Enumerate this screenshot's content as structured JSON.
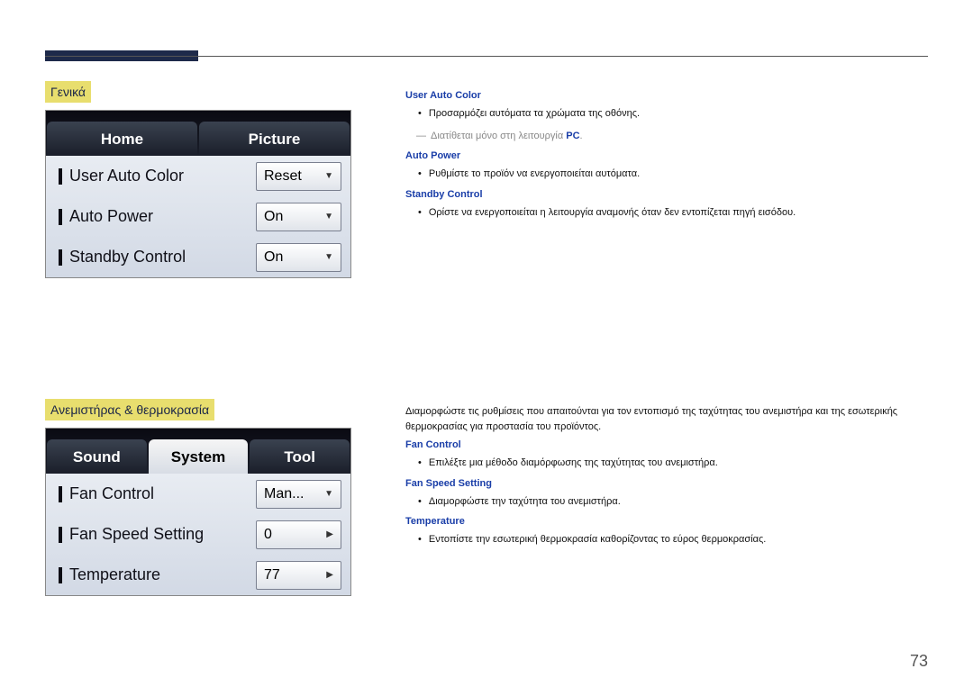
{
  "page_number": "73",
  "section1": {
    "label": "Γενικά",
    "tabs": [
      "Home",
      "Picture"
    ],
    "active_tab_index": 0,
    "rows": [
      {
        "name": "User Auto Color",
        "value": "Reset",
        "kind": "dropdown"
      },
      {
        "name": "Auto Power",
        "value": "On",
        "kind": "dropdown"
      },
      {
        "name": "Standby Control",
        "value": "On",
        "kind": "dropdown"
      }
    ],
    "desc": [
      {
        "h": "User Auto Color",
        "bullet": "Προσαρμόζει αυτόματα τα χρώματα της οθόνης.",
        "note_pre": "Διατίθεται μόνο στη λειτουργία ",
        "note_pc": "PC",
        "note_post": "."
      },
      {
        "h": "Auto Power",
        "bullet": "Ρυθμίστε το προϊόν να ενεργοποιείται αυτόματα."
      },
      {
        "h": "Standby Control",
        "bullet": "Ορίστε να ενεργοποιείται η λειτουργία αναμονής όταν δεν εντοπίζεται πηγή εισόδου."
      }
    ]
  },
  "section2": {
    "label": "Ανεμιστήρας & θερμοκρασία",
    "tabs": [
      "Sound",
      "System",
      "Tool"
    ],
    "active_tab_index": 1,
    "rows": [
      {
        "name": "Fan Control",
        "value": "Man...",
        "kind": "dropdown"
      },
      {
        "name": "Fan Speed Setting",
        "value": "0",
        "kind": "spinner"
      },
      {
        "name": "Temperature",
        "value": "77",
        "kind": "spinner"
      }
    ],
    "intro": "Διαμορφώστε τις ρυθμίσεις που απαιτούνται για τον εντοπισμό της ταχύτητας του ανεμιστήρα και της εσωτερικής θερμοκρασίας για προστασία του προϊόντος.",
    "desc": [
      {
        "h": "Fan Control",
        "bullet": "Επιλέξτε μια μέθοδο διαμόρφωσης της ταχύτητας του ανεμιστήρα."
      },
      {
        "h": "Fan Speed Setting",
        "bullet": "Διαμορφώστε την ταχύτητα του ανεμιστήρα."
      },
      {
        "h": "Temperature",
        "bullet": "Εντοπίστε την εσωτερική θερμοκρασία καθορίζοντας το εύρος θερμοκρασίας."
      }
    ]
  }
}
